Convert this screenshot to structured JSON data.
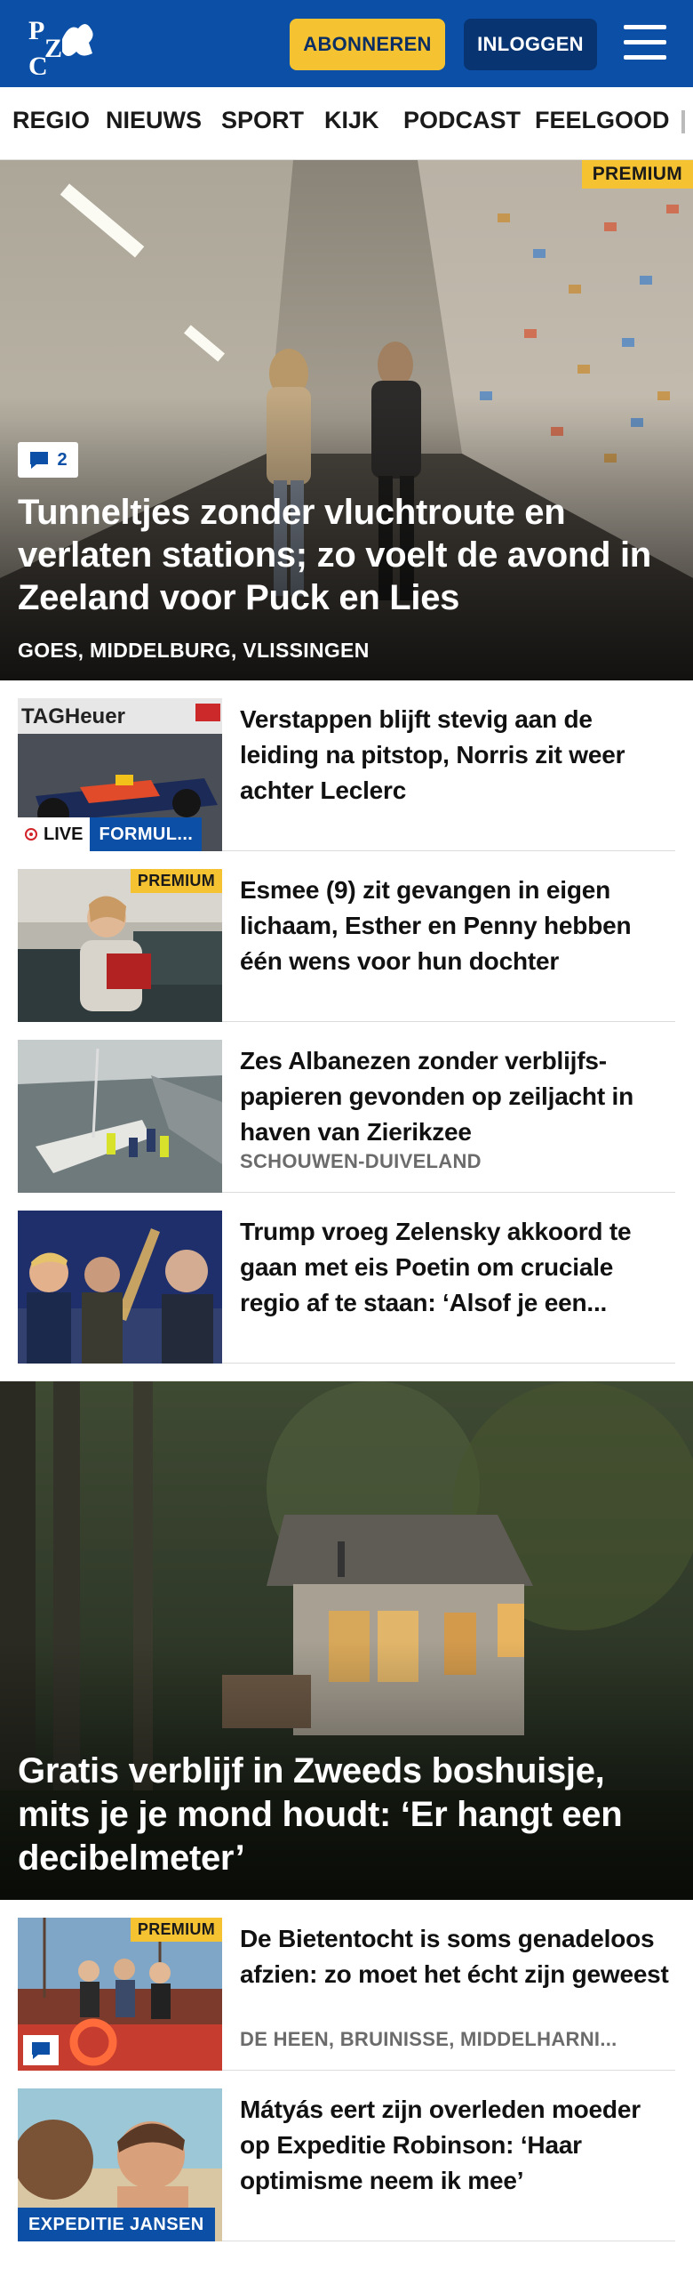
{
  "header": {
    "logo_text": "PZC",
    "subscribe_label": "ABONNEREN",
    "login_label": "INLOGGEN",
    "menu_icon": "hamburger-menu-icon",
    "brand_color": "#0c4fa6",
    "accent_color": "#f5c332"
  },
  "nav": {
    "items": [
      "REGIO",
      "NIEUWS",
      "SPORT",
      "KIJK",
      "PODCAST",
      "FEELGOOD"
    ]
  },
  "hero": {
    "badge": "PREMIUM",
    "comment_count": "2",
    "title": "Tunneltjes zonder vluchtroute en verlaten stations; zo voelt de avond in Zeeland voor Puck en Lies",
    "location": "GOES, MIDDELBURG, VLISSINGEN"
  },
  "articles": [
    {
      "title": "Verstappen blijft stevig aan de leiding na pitstop, Norris zit weer achter Leclerc",
      "live_label": "LIVE",
      "category": "FORMUL..."
    },
    {
      "title": "Esmee (9) zit gevangen in eigen lichaam, Esther en Penny hebben één wens voor hun dochter",
      "badge": "PREMIUM"
    },
    {
      "title": "Zes Albanezen zonder verblijfs­papieren gevonden op zeiljacht in haven van Zierikzee",
      "location": "SCHOUWEN-DUIVELAND"
    },
    {
      "title": "Trump vroeg Zelensky akkoord te gaan met eis Poetin om cruciale regio af te staan: ‘Alsof je een..."
    }
  ],
  "feature": {
    "title": "Gratis verblijf in Zweeds boshuisje, mits je je mond houdt: ‘Er hangt een decibelmeter’"
  },
  "articles2": [
    {
      "title": "De Bietentocht is soms genadeloos afzien: zo moet het écht zijn geweest",
      "badge": "PREMIUM",
      "location": "DE HEEN, BRUINISSE, MIDDELHARNI..."
    },
    {
      "title": "Mátyás eert zijn overleden moeder op Expeditie Robinson: ‘Haar optimisme neem ik mee’",
      "category": "EXPEDITIE JANSEN"
    }
  ]
}
